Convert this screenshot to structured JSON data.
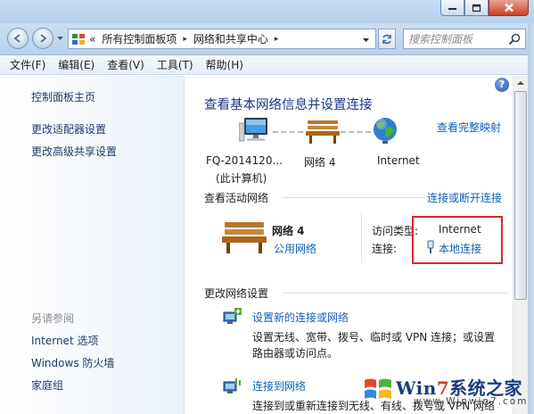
{
  "window": {
    "buttons": {
      "minimize": "minimize-icon",
      "maximize": "maximize-icon",
      "close": "close-icon"
    }
  },
  "nav": {
    "breadcrumb_sep_first": "«",
    "breadcrumb": [
      "所有控制面板项",
      "网络和共享中心"
    ],
    "breadcrumb_sep": "▸",
    "search_placeholder": "搜索控制面板"
  },
  "menu": [
    "文件(F)",
    "编辑(E)",
    "查看(V)",
    "工具(T)",
    "帮助(H)"
  ],
  "sidebar": {
    "links": [
      "控制面板主页",
      "更改适配器设置",
      "更改高级共享设置"
    ],
    "see_also_title": "另请参阅",
    "see_also": [
      "Internet 选项",
      "Windows 防火墙",
      "家庭组"
    ]
  },
  "main": {
    "help": "?",
    "heading": "查看基本网络信息并设置连接",
    "full_map_link": "查看完整映射",
    "map": {
      "computer_name": "FQ-2014120...",
      "computer_sub": "(此计算机)",
      "network": "网络  4",
      "internet": "Internet"
    },
    "active": {
      "section_title": "查看活动网络",
      "connect_disconnect": "连接或断开连接",
      "network_name": "网络  4",
      "network_type": "公用网络",
      "access_type_label": "访问类型:",
      "access_type_value": "Internet",
      "connections_label": "连接:",
      "connections_value": "本地连接"
    },
    "change": {
      "section_title": "更改网络设置",
      "tasks": [
        {
          "title": "设置新的连接或网络",
          "desc": [
            "设置无线、宽带、拨号、临时或 VPN 连接；或设置",
            "路由器或访问点。"
          ]
        },
        {
          "title": "连接到网络",
          "desc": [
            "连接到或重新连接到无线、有线、拨号或 VPN 网络"
          ]
        }
      ]
    }
  },
  "watermark": {
    "text_a": "Win",
    "text_7": "7",
    "text_b": "系统之家",
    "sub": "www.Winwin7.com"
  }
}
